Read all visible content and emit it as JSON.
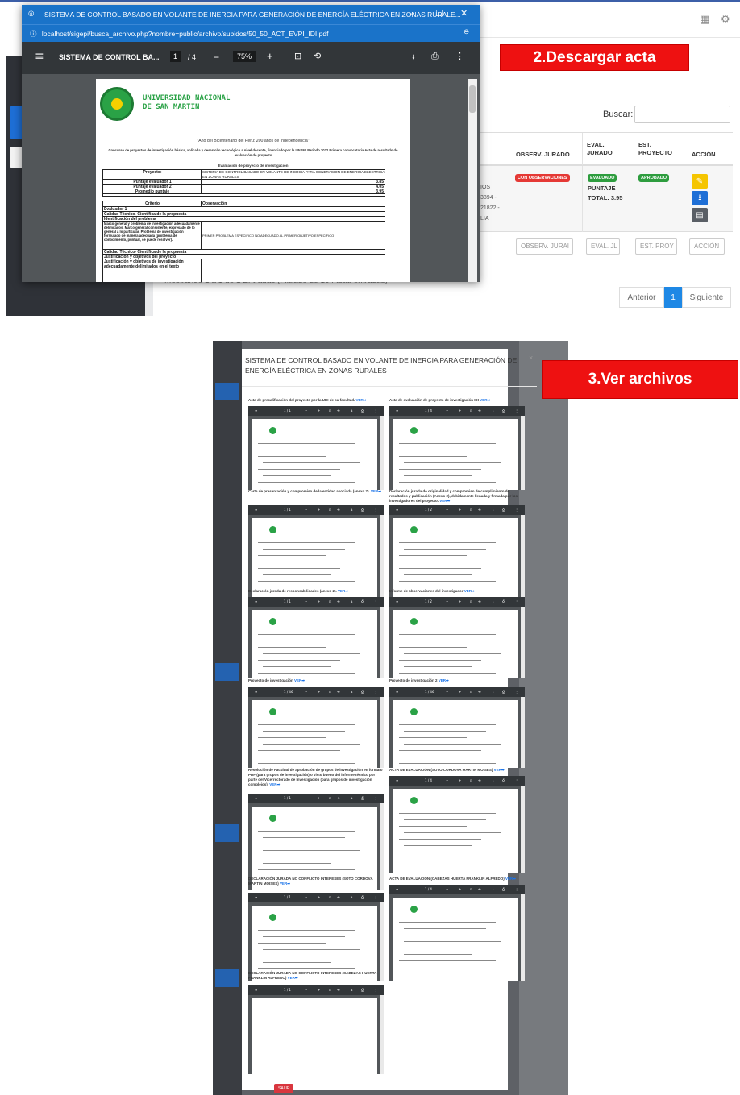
{
  "annotations": {
    "descargar": "2.Descargar acta",
    "ver_archivos": "3.Ver archivos"
  },
  "pdf_window": {
    "title": "SISTEMA DE CONTROL BASADO EN VOLANTE DE INERCIA PARA GENERACIÓN DE ENERGÍA ELÉCTRICA EN ZONAS RURALE...",
    "address": "localhost/sigepi/busca_archivo.php?nombre=public/archivo/subidos/50_50_ACT_EVPI_IDI.pdf",
    "toolbar": {
      "doc_title": "SISTEMA DE CONTROL BA...",
      "page": "1",
      "pages": "/ 4",
      "zoom": "75%"
    },
    "document": {
      "university_line1": "UNIVERSIDAD NACIONAL",
      "university_line2": "DE SAN MARTIN",
      "year_motto": "\"Año del Bicentenario del Perú: 200 años de Independencia\"",
      "contest": "Concurso de proyectos de investigación básica, aplicada y desarrollo tecnológico a nivel docente, financiado por la UNSM, Periodo 2022 Primera convocatoria Acta de resultado de evaluación de proyecto",
      "section_title": "Evaluación de proyecto de investigación",
      "project_label": "Proyecto:",
      "project_value": "SISTEMA DE CONTROL BASADO EN VOLANTE DE INERCIA PARA GENERACION DE ENERGIA ELECTRICA EN ZONAS RURALES",
      "score1_label": "Puntaje evaluador 1",
      "score1": "3.85",
      "score2_label": "Puntaje evaluador 2",
      "score2": "4.05",
      "avg_label": "Promedio puntaje",
      "avg": "3.95",
      "criteria_header": "Criterio",
      "observation_header": "Observación",
      "rows": [
        "Evaluador 1",
        "Calidad Técnico- Científica de la propuesta",
        "Identificación del problema",
        "Marco general y problema de investigación adecuadamente delimitados. Marco general consistente, expresado de lo general a lo particular. Problema de investigación formulado de manera adecuada (problema de conocimiento, puntual, se puede resolver).",
        "Calidad Técnico- Científica de la propuesta",
        "Justificación y objetivos del proyecto",
        "Justificación y objetivos de investigación adecuadamente delimitados en el texto"
      ],
      "observation_1": "PRIMER PROBLEMA ESPECIFICO NO ADECUADO AL PRIMER OBJETIVO ESPECIFICO"
    }
  },
  "background_table": {
    "search_label": "Buscar:",
    "headers": [
      "OBSERV. JURADO",
      "EVAL. JURADO",
      "EST. PROYECTO",
      "ACCIÓN"
    ],
    "row": {
      "badge_observ": "CON OBSERVACIONES",
      "badge_eval": "EVALUADO",
      "score_label": "PUNTAJE",
      "score_total": "TOTAL: 3.95",
      "badge_estado": "APROBADO",
      "partial_text": [
        "IOS",
        "3894 -",
        "21822 -",
        "LIA"
      ]
    },
    "filters": [
      "OBSERV. JURAI",
      "EVAL. JL",
      "EST. PROY",
      "ACCIÓN"
    ],
    "showing": "Mostrando 1 a 1 de 1 Entradas (Filtrado de 104 total entradas)",
    "pager": {
      "prev": "Anterior",
      "current": "1",
      "next": "Siguiente"
    }
  },
  "modal": {
    "title": "SISTEMA DE CONTROL BASADO EN VOLANTE DE INERCIA PARA GENERACIÓN DE ENERGÍA ELÉCTRICA EN ZONAS RURALES",
    "close": "×",
    "ver": "VER➡",
    "files": [
      {
        "title": "Acta de precalificación del proyecto por la UDI de su facultad."
      },
      {
        "title": "Acta de evaluación de proyecto de investigación IDI"
      },
      {
        "title": "Carta de presentación y compromiso de la entidad asociada (anexo 7)."
      },
      {
        "title": "Declaración jurada de originalidad y compromiso de cumplimiento de resultados y publicación (Anexo 2), debidamente llenada y firmada por los investigadores del proyecto."
      },
      {
        "title": "Declaración jurada de responsabilidades (anexo 2)."
      },
      {
        "title": "Informe de observaciones del investigador"
      },
      {
        "title": "Proyecto de investigación"
      },
      {
        "title": "Proyecto de investigación 2"
      },
      {
        "title": "Resolución de Facultad de aprobación de grupos de investigación en formato PDF (para grupos de investigación) o visto bueno del informe técnico por parte del Vicerrectorado de Investigación (para grupos de investigación complejos)."
      },
      {
        "title": "ACTA DE EVALUACIÓN (SOTO CORDOVA MARTIN MOISES)"
      },
      {
        "title": "DECLARACIÓN JURADA NO CONFLICTO INTERESES (SOTO CORDOVA MARTIN MOISES)"
      },
      {
        "title": "ACTA DE EVALUACIÓN (CABEZAS HUERTA FRANKLIN ALFREDO)"
      },
      {
        "title": "DECLARACIÓN JURADA NO CONFLICTO INTERESES (CABEZAS HUERTA FRANKLIN ALFREDO)"
      }
    ],
    "viewer_pages": [
      "1 / 1",
      "1 / 4",
      "1 / 1",
      "1 / 2",
      "1 / 1",
      "1 / 2",
      "1 / 46",
      "1 / 46",
      "1 / 1",
      "1 / 4",
      "1 / 1",
      "1 / 4",
      "1 / 1"
    ],
    "exit_button": "SALIR"
  },
  "colors": {
    "red_label": "#ee1111",
    "window_blue": "#1a73c9",
    "badge_red": "#e53935",
    "badge_green": "#2e9d3f",
    "brand_green": "#2aa246"
  }
}
